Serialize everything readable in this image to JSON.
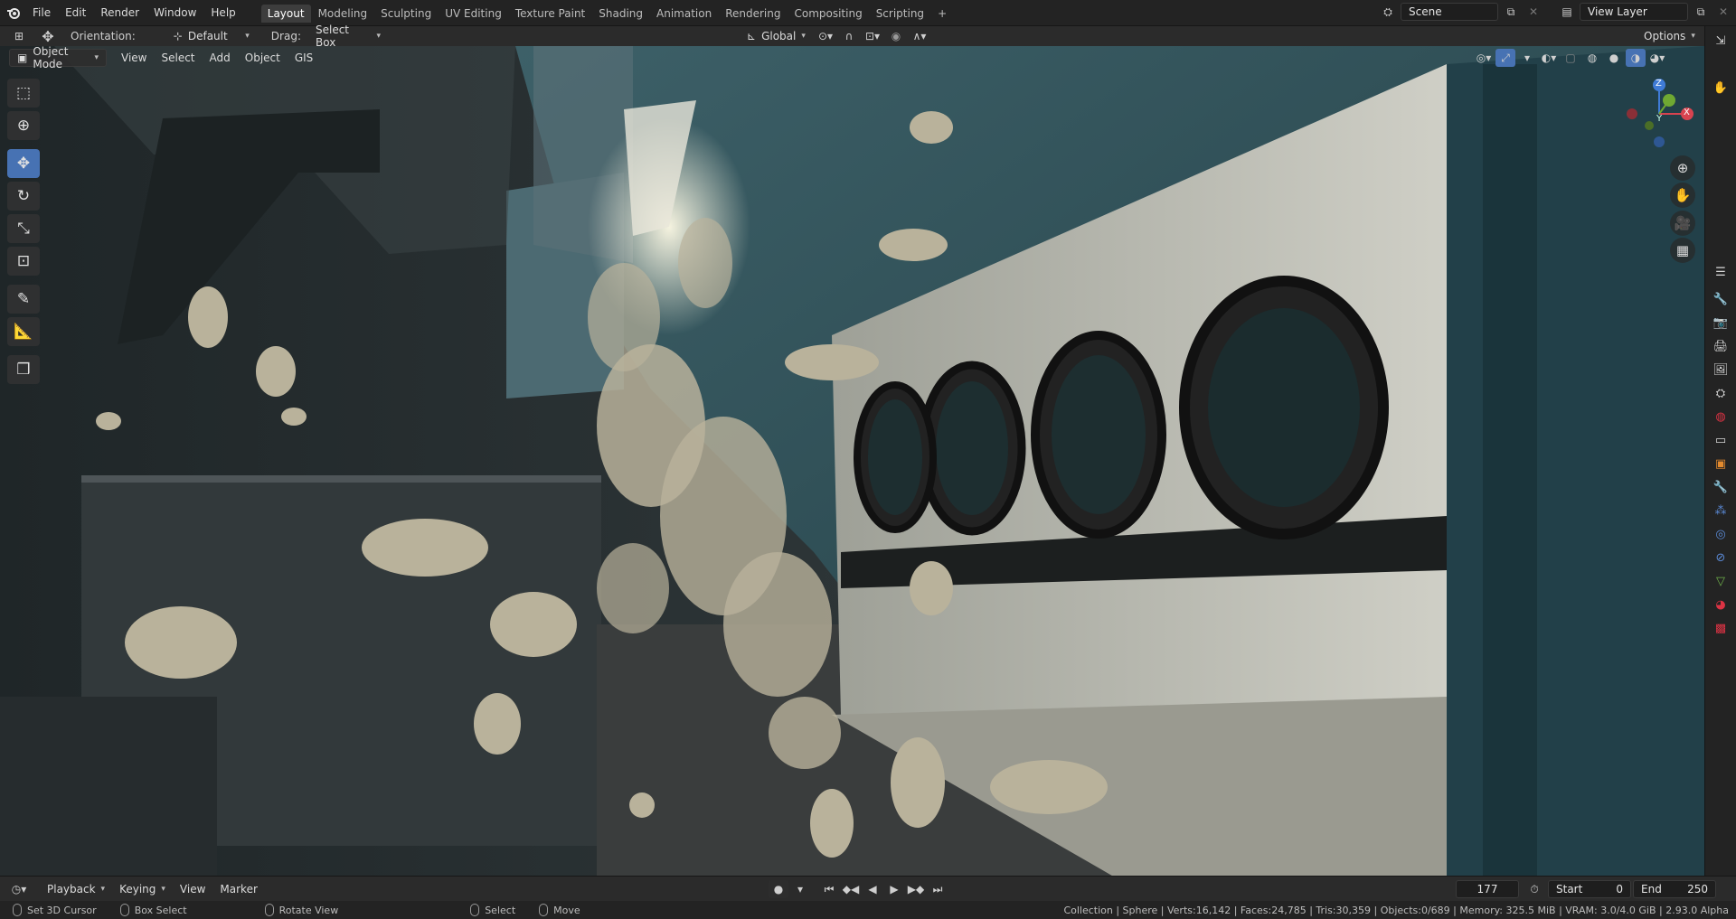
{
  "app": {
    "logo": "blender-logo-icon"
  },
  "menus": [
    "File",
    "Edit",
    "Render",
    "Window",
    "Help"
  ],
  "workspaces": [
    {
      "label": "Layout",
      "active": true
    },
    {
      "label": "Modeling"
    },
    {
      "label": "Sculpting"
    },
    {
      "label": "UV Editing"
    },
    {
      "label": "Texture Paint"
    },
    {
      "label": "Shading"
    },
    {
      "label": "Animation"
    },
    {
      "label": "Rendering"
    },
    {
      "label": "Compositing"
    },
    {
      "label": "Scripting"
    }
  ],
  "add_workspace": "+",
  "scene": {
    "value": "Scene"
  },
  "view_layer": {
    "value": "View Layer"
  },
  "header": {
    "orientation_label": "Orientation:",
    "orientation_value": "Default",
    "drag_label": "Drag:",
    "drag_value": "Select Box",
    "transform_orientation": "Global",
    "options_label": "Options"
  },
  "viewport_header": {
    "mode": "Object Mode",
    "menus": [
      "View",
      "Select",
      "Add",
      "Object",
      "GIS"
    ]
  },
  "gizmo": {
    "x": "X",
    "y": "Y",
    "z": "Z"
  },
  "timeline": {
    "menus": [
      "Playback",
      "Keying",
      "View",
      "Marker"
    ],
    "current_frame": "177",
    "start_label": "Start",
    "start_value": "0",
    "end_label": "End",
    "end_value": "250"
  },
  "status": {
    "set_cursor": "Set 3D Cursor",
    "box_select": "Box Select",
    "rotate_view": "Rotate View",
    "select": "Select",
    "move": "Move",
    "stats": "Collection | Sphere | Verts:16,142 | Faces:24,785 | Tris:30,359 | Objects:0/689 | Memory: 325.5 MiB | VRAM: 3.0/4.0 GiB | 2.93.0 Alpha"
  },
  "colors": {
    "accent": "#4772b3",
    "bg": "#232323",
    "header": "#2b2b2b"
  }
}
